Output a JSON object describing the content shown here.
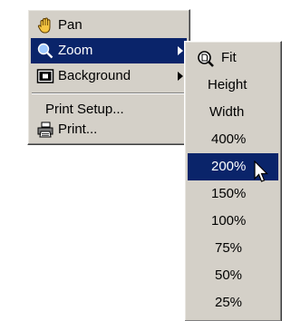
{
  "main_menu": {
    "items": [
      {
        "label": "Pan",
        "icon": "hand-icon"
      },
      {
        "label": "Zoom",
        "icon": "zoom-magnifier-icon",
        "submenu": true,
        "selected": true
      },
      {
        "label": "Background",
        "icon": "background-icon",
        "submenu": true
      },
      {
        "label": "Print Setup..."
      },
      {
        "label": "Print...",
        "icon": "printer-icon"
      }
    ]
  },
  "zoom_submenu": {
    "items": [
      {
        "label": "Fit",
        "icon": "zoom-fit-icon"
      },
      {
        "label": "Height"
      },
      {
        "label": "Width"
      },
      {
        "label": "400%"
      },
      {
        "label": "200%",
        "selected": true
      },
      {
        "label": "150%"
      },
      {
        "label": "100%"
      },
      {
        "label": "75%"
      },
      {
        "label": "50%"
      },
      {
        "label": "25%"
      }
    ]
  },
  "colors": {
    "menu_background": "#d4d0c8",
    "highlight": "#0a246a",
    "highlight_text": "#ffffff"
  }
}
